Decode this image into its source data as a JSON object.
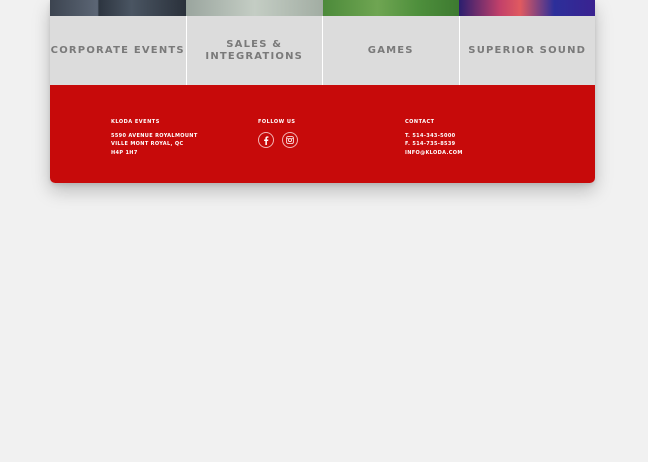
{
  "tiles": [
    {
      "label": "CORPORATE EVENTS"
    },
    {
      "label": "SALES &\nINTEGRATIONS"
    },
    {
      "label": "GAMES"
    },
    {
      "label": "SUPERIOR SOUND"
    }
  ],
  "footer": {
    "address": {
      "title": "KLODA EVENTS",
      "lines": [
        "5590 AVENUE ROYALMOUNT",
        "VILLE MONT ROYAL, QC",
        "H4P 1H7"
      ]
    },
    "follow": {
      "title": "FOLLOW US",
      "icons": [
        "facebook-icon",
        "instagram-icon"
      ]
    },
    "contact": {
      "title": "CONTACT",
      "lines": [
        "T. 514-343-5000",
        "F. 514-735-8539",
        "INFO@KLODA.COM"
      ]
    }
  },
  "colors": {
    "footer_bg": "#c70a0a",
    "tile_bg": "#dcdcdc",
    "tile_text": "#7a7a7a",
    "page_bg": "#f1f1f1"
  }
}
